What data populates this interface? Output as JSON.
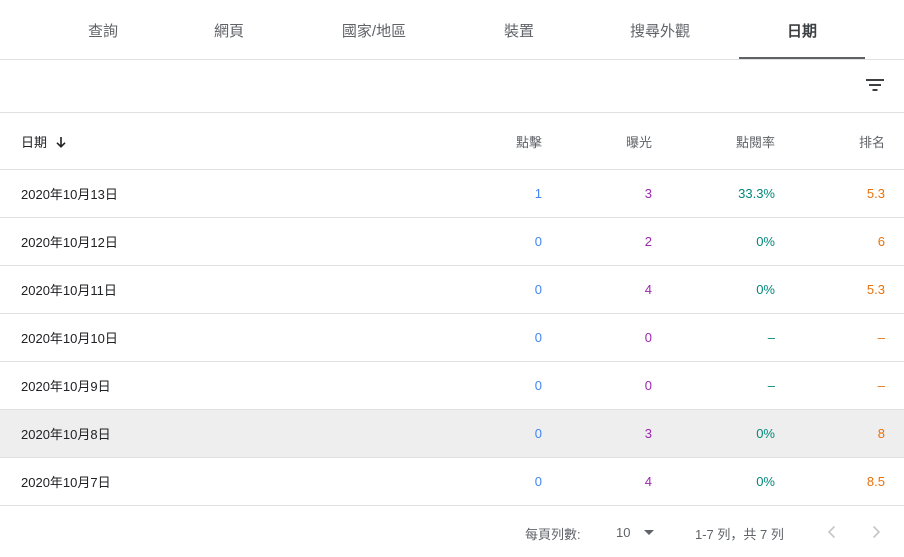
{
  "tabs": [
    {
      "label": "查詢",
      "active": false
    },
    {
      "label": "網頁",
      "active": false
    },
    {
      "label": "國家/地區",
      "active": false
    },
    {
      "label": "裝置",
      "active": false
    },
    {
      "label": "搜尋外觀",
      "active": false
    },
    {
      "label": "日期",
      "active": true
    }
  ],
  "toolbar": {
    "filter_icon": "filter-list-icon"
  },
  "table": {
    "headers": {
      "date": "日期",
      "clicks": "點擊",
      "impressions": "曝光",
      "ctr": "點閱率",
      "position": "排名"
    },
    "sort_icon": "arrow-downward-icon",
    "rows": [
      {
        "date": "2020年10月13日",
        "clicks": "1",
        "impressions": "3",
        "ctr": "33.3%",
        "position": "5.3"
      },
      {
        "date": "2020年10月12日",
        "clicks": "0",
        "impressions": "2",
        "ctr": "0%",
        "position": "6"
      },
      {
        "date": "2020年10月11日",
        "clicks": "0",
        "impressions": "4",
        "ctr": "0%",
        "position": "5.3"
      },
      {
        "date": "2020年10月10日",
        "clicks": "0",
        "impressions": "0",
        "ctr": "–",
        "position": "–"
      },
      {
        "date": "2020年10月9日",
        "clicks": "0",
        "impressions": "0",
        "ctr": "–",
        "position": "–"
      },
      {
        "date": "2020年10月8日",
        "clicks": "0",
        "impressions": "3",
        "ctr": "0%",
        "position": "8"
      },
      {
        "date": "2020年10月7日",
        "clicks": "0",
        "impressions": "4",
        "ctr": "0%",
        "position": "8.5"
      }
    ]
  },
  "pagination": {
    "rows_per_page_label": "每頁列數:",
    "rows_per_page_value": "10",
    "range_label": "1-7 列，共 7 列",
    "prev_icon": "chevron-left-icon",
    "next_icon": "chevron-right-icon"
  },
  "colors": {
    "clicks": "#4285f4",
    "impressions": "#9c27b0",
    "ctr": "#00897b",
    "position": "#e8710a"
  }
}
